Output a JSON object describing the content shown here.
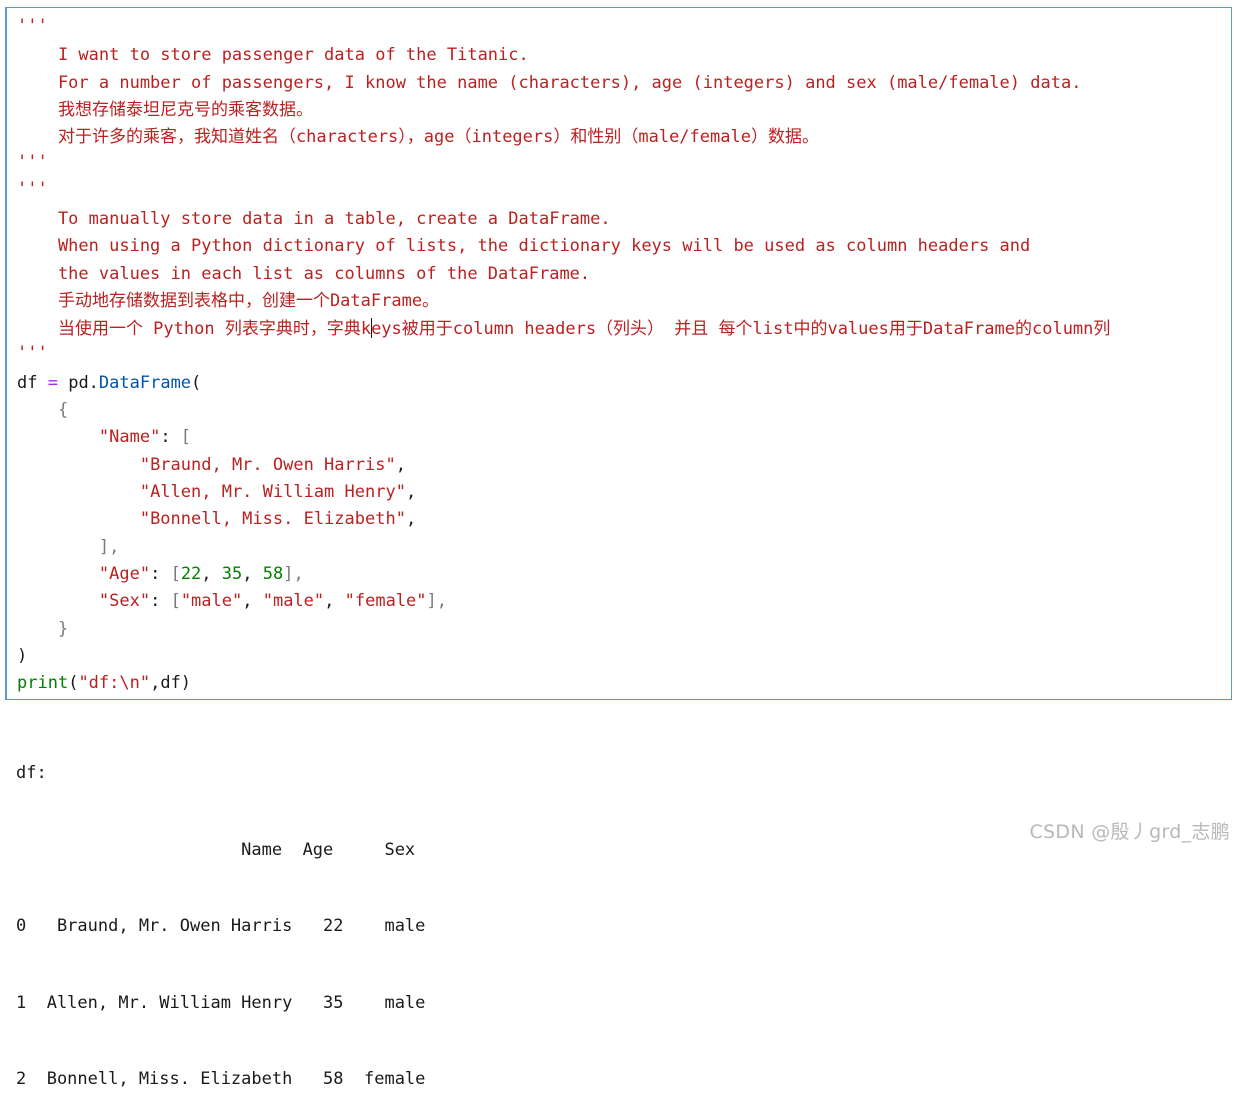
{
  "code_cell": {
    "docstring1": {
      "open": "'''",
      "en1": "    I want to store passenger data of the Titanic.",
      "en2": "    For a number of passengers, I know the name (characters), age (integers) and sex (male/female) data.",
      "zh1": "    我想存储泰坦尼克号的乘客数据。",
      "zh2": "    对于许多的乘客，我知道姓名（characters），age（integers）和性别（male/female）数据。",
      "close": "'''"
    },
    "docstring2": {
      "open": "'''",
      "en1": "    To manually store data in a table, create a DataFrame.",
      "en2": "    When using a Python dictionary of lists, the dictionary keys will be used as column headers and",
      "en3": "    the values in each list as columns of the DataFrame.",
      "zh1": "    手动地存储数据到表格中，创建一个DataFrame。",
      "zh2_before_cursor": "    当使用一个 Python 列表字典时，字典k",
      "zh2_after_cursor": "eys被用于column headers（列头） 并且 每个list中的values用于DataFrame的column列",
      "close": "'''"
    },
    "code": {
      "df": "df",
      "assign": " = ",
      "pd": "pd.",
      "DataFrame": "DataFrame",
      "open_paren": "(",
      "open_brace": "    {",
      "name_key": "\"Name\"",
      "name_colon": ": ",
      "name_open": "[",
      "name1": "\"Braund, Mr. Owen Harris\"",
      "name2": "\"Allen, Mr. William Henry\"",
      "name3": "\"Bonnell, Miss. Elizabeth\"",
      "comma": ",",
      "name_close": "],",
      "age_key": "\"Age\"",
      "age_colon": ": ",
      "age_open": "[",
      "age1": "22",
      "age2": "35",
      "age3": "58",
      "age_sep": ", ",
      "age_close": "],",
      "sex_key": "\"Sex\"",
      "sex_colon": ": ",
      "sex_open": "[",
      "sex1": "\"male\"",
      "sex2": "\"male\"",
      "sex3": "\"female\"",
      "sex_sep": ", ",
      "sex_close": "],",
      "close_brace": "    }",
      "close_paren": ")",
      "print_kw": "print",
      "print_open": "(",
      "print_str": "\"df:\\n\"",
      "print_args": ",df)"
    }
  },
  "output": {
    "label": "df:",
    "header": "                      Name  Age     Sex",
    "rows": [
      "0   Braund, Mr. Owen Harris   22    male",
      "1  Allen, Mr. William Henry   35    male",
      "2  Bonnell, Miss. Elizabeth   58  female"
    ]
  },
  "watermark": "CSDN @殷丿grd_志鹏"
}
